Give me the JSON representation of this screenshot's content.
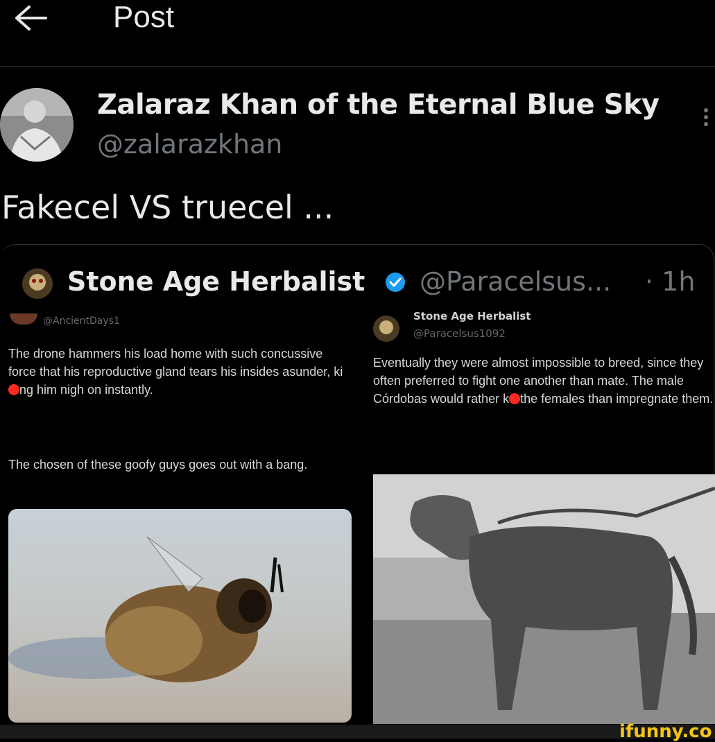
{
  "header": {
    "title": "Post",
    "back_icon": "arrow-left-icon"
  },
  "post": {
    "author_name": "Zalaraz Khan of the Eternal Blue Sky",
    "author_handle": "@zalarazkhan",
    "text": "Fakecel VS truecel ..."
  },
  "quote": {
    "name": "Stone Age Herbalist",
    "handle": "@Paracelsus...",
    "time": "· 1h",
    "left": {
      "handle": "@AncientDays1",
      "text1_a": "The drone hammers his load home with such concussive force that his reproductive gland tears his insides asunder, ki",
      "text1_b": "ng him nigh on instantly.",
      "text2": "The chosen of these goofy guys goes out with a bang."
    },
    "right": {
      "name": "Stone Age Herbalist",
      "handle": "@Paracelsus1092",
      "text_a": "Eventually they were almost impossible to breed, since they often preferred to fight one another than mate. The male Córdobas would rather k",
      "text_b": "the females than impregnate them."
    }
  },
  "watermark": "ifunny.co",
  "colors": {
    "background": "#000000",
    "text": "#e7e9ea",
    "muted": "#71767b",
    "verified": "#1d9bf0",
    "censor_dot": "#ff2a1f",
    "watermark": "#f5c518"
  }
}
